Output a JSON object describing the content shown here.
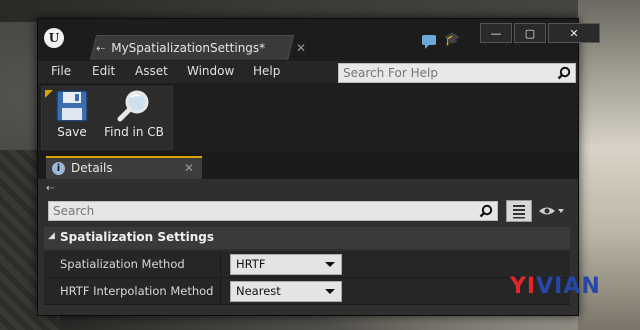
{
  "window": {
    "title_tab": "MySpatializationSettings*",
    "controls": {
      "minimize": "—",
      "maximize": "▢",
      "close": "✕"
    }
  },
  "menu": {
    "items": [
      "File",
      "Edit",
      "Asset",
      "Window",
      "Help"
    ],
    "search_placeholder": "Search For Help"
  },
  "toolbar": {
    "save_label": "Save",
    "find_label": "Find in CB"
  },
  "details": {
    "tab_label": "Details",
    "search_placeholder": "Search",
    "category": "Spatialization Settings",
    "properties": [
      {
        "name": "Spatialization Method",
        "value": "HRTF"
      },
      {
        "name": "HRTF Interpolation Method",
        "value": "Nearest"
      }
    ]
  },
  "watermark": {
    "part1": "YI",
    "part2": "VIAN"
  },
  "colors": {
    "accent": "#d8a400",
    "watermark_red": "#e3262a",
    "watermark_blue": "#2447a8",
    "help_icon": "#6aa9d8"
  }
}
